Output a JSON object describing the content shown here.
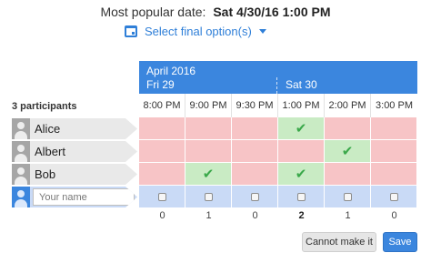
{
  "header": {
    "popular_label": "Most popular date:",
    "popular_value": "Sat 4/30/16 1:00 PM",
    "select_final": "Select final option(s)"
  },
  "calendar": {
    "month": "April 2016",
    "days": [
      "Fri 29",
      "Sat 30"
    ],
    "times": [
      "8:00 PM",
      "9:00 PM",
      "9:30 PM",
      "1:00 PM",
      "2:00 PM",
      "3:00 PM"
    ]
  },
  "participants": {
    "count_label": "3 participants",
    "rows": [
      {
        "name": "Alice",
        "votes": [
          "no",
          "no",
          "no",
          "yes",
          "no",
          "no"
        ]
      },
      {
        "name": "Albert",
        "votes": [
          "no",
          "no",
          "no",
          "no",
          "yes",
          "no"
        ]
      },
      {
        "name": "Bob",
        "votes": [
          "no",
          "yes",
          "no",
          "yes",
          "no",
          "no"
        ]
      }
    ],
    "input_placeholder": "Your name"
  },
  "totals": [
    "0",
    "1",
    "0",
    "2",
    "1",
    "0"
  ],
  "colors": {
    "accent": "#3b86de",
    "yes": "#c9ebc4",
    "no": "#f7c4c6",
    "input_row": "#c9daf6"
  },
  "icons": {
    "calendar": "calendar-icon",
    "caret": "chevron-down-icon",
    "avatar": "user-icon",
    "check": "checkmark-icon"
  },
  "actions": {
    "cannot": "Cannot make it",
    "save": "Save"
  }
}
